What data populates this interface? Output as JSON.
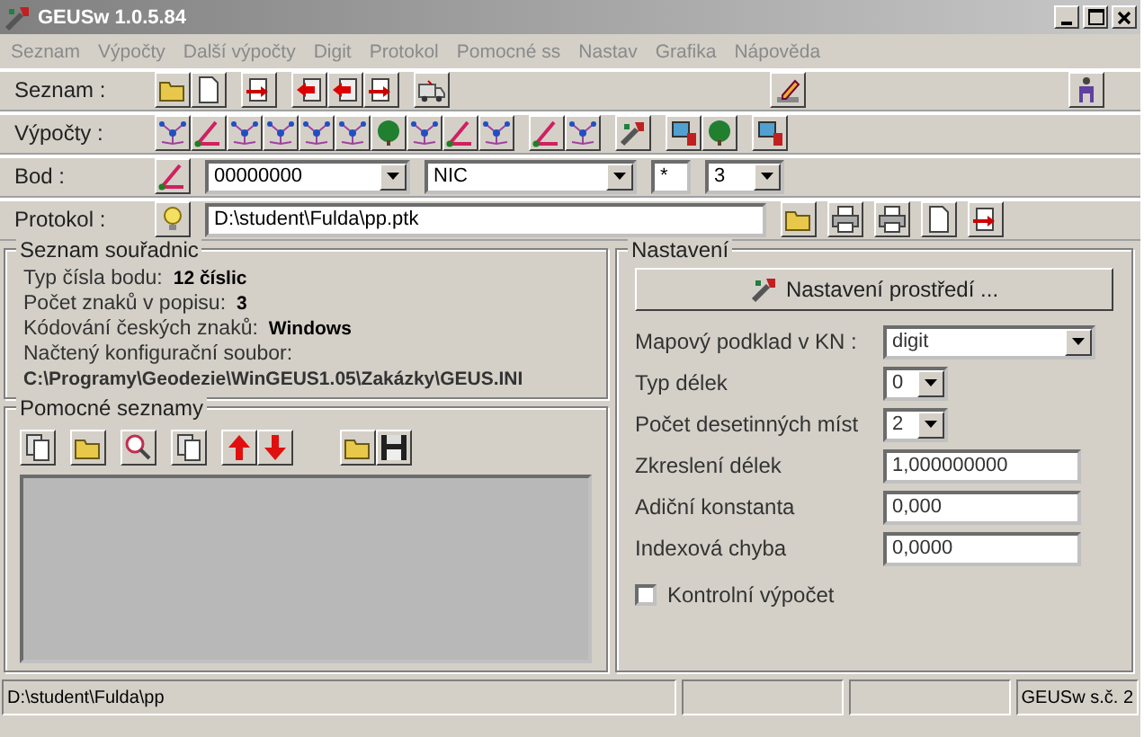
{
  "window": {
    "title": "GEUSw 1.0.5.84"
  },
  "menu": [
    "Seznam",
    "Výpočty",
    "Další výpočty",
    "Digit",
    "Protokol",
    "Pomocné ss",
    "Nastav",
    "Grafika",
    "Nápověda"
  ],
  "toolbar_rows": [
    {
      "kind": "seznam",
      "label": "Seznam :"
    },
    {
      "kind": "vypocty",
      "label": "Výpočty :"
    },
    {
      "kind": "bod",
      "label": "Bod :",
      "point_number": "00000000",
      "code": "NIC",
      "mask": "*",
      "count": "3"
    },
    {
      "kind": "protokol",
      "label": "Protokol :",
      "path": "D:\\student\\Fulda\\pp.ptk"
    }
  ],
  "coordinate_list": {
    "title": "Seznam souřadnic",
    "items": [
      {
        "label": "Typ čísla bodu:",
        "value": "12 číslic"
      },
      {
        "label": "Počet znaků v popisu:",
        "value": "3"
      },
      {
        "label": "Kódování českých znaků:",
        "value": "Windows"
      }
    ],
    "config_label": "Načtený konfigurační soubor:",
    "config_path": "C:\\Programy\\Geodezie\\WinGEUS1.05\\Zakázky\\GEUS.INI"
  },
  "helper_lists": {
    "title": "Pomocné seznamy"
  },
  "settings": {
    "title": "Nastavení",
    "button": "Nastavení prostředí ...",
    "fields": [
      {
        "kind": "combo",
        "label": "Mapový podklad v KN :",
        "value": "digit"
      },
      {
        "kind": "small_combo",
        "label": "Typ délek",
        "value": "0"
      },
      {
        "kind": "small_combo",
        "label": "Počet desetinných míst",
        "value": "2"
      },
      {
        "kind": "text",
        "label": "Zkreslení délek",
        "value": "1,000000000"
      },
      {
        "kind": "text",
        "label": "Adiční konstanta",
        "value": "0,000"
      },
      {
        "kind": "text",
        "label": "Indexová chyba",
        "value": "0,0000"
      }
    ],
    "checkbox": {
      "label": "Kontrolní výpočet",
      "checked": false
    }
  },
  "status_bar": {
    "path": "D:\\student\\Fulda\\pp",
    "info": "GEUSw s.č. 2"
  }
}
